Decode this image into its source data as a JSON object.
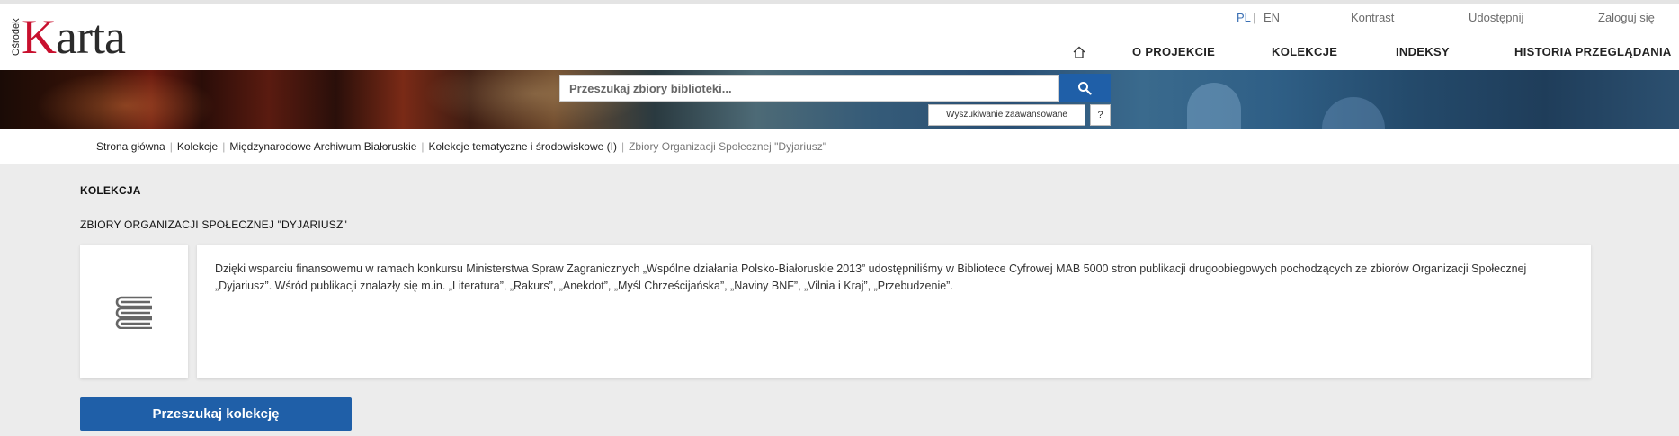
{
  "logo": {
    "sub": "Ośrodek",
    "k": "K",
    "rest": "arta"
  },
  "toplinks": {
    "lang_pl": "PL",
    "sep": "|",
    "lang_en": "EN",
    "contrast": "Kontrast",
    "share": "Udostępnij",
    "login": "Zaloguj się"
  },
  "nav": {
    "about": "O PROJEKCIE",
    "collections": "KOLEKCJE",
    "indexes": "INDEKSY",
    "history": "HISTORIA PRZEGLĄDANIA"
  },
  "search": {
    "placeholder": "Przeszukaj zbiory biblioteki...",
    "advanced": "Wyszukiwanie zaawansowane",
    "help": "?"
  },
  "breadcrumb": {
    "items": [
      "Strona główna",
      "Kolekcje",
      "Międzynarodowe Archiwum Białoruskie",
      "Kolekcje tematyczne i środowiskowe (I)"
    ],
    "current": "Zbiory Organizacji Społecznej \"Dyjariusz\""
  },
  "collection": {
    "section_label": "KOLEKCJA",
    "title": "ZBIORY ORGANIZACJI SPOŁECZNEJ \"DYJARIUSZ\"",
    "description": "Dzięki wsparciu finansowemu w ramach konkursu Ministerstwa Spraw Zagranicznych „Wspólne działania Polsko-Białoruskie 2013” udostępniliśmy w Bibliotece Cyfrowej MAB 5000 stron publikacji drugoobiegowych pochodzących ze zbiorów Organizacji Społecznej „Dyjariusz”. Wśród publikacji znalazły się m.in. „Literatura”, „Rakurs”, „Anekdot”, „Myśl Chrześcijańska”, „Naviny BNF”, „Vilnia i Kraj”, „Przebudzenie”.",
    "search_button": "Przeszukaj kolekcję"
  },
  "colors": {
    "accent": "#1f5fa8",
    "logo_red": "#c8102e"
  },
  "icons": {
    "home": "home-icon",
    "search": "search-icon",
    "collection": "books-icon"
  }
}
